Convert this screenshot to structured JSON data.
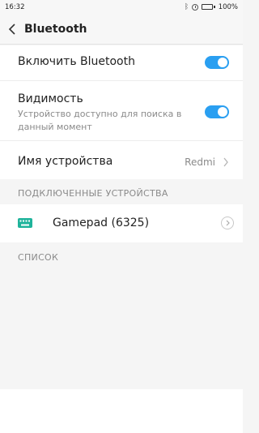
{
  "status_bar": {
    "time": "16:32",
    "battery": "100%",
    "bluetooth_icon": "bluetooth-icon",
    "alarm_icon": "alarm-icon",
    "battery_icon": "battery-icon"
  },
  "header": {
    "title": "Bluetooth",
    "back_icon": "chevron-left-icon"
  },
  "settings": {
    "enable_bluetooth": {
      "label": "Включить Bluetooth",
      "enabled": true
    },
    "visibility": {
      "label": "Видимость",
      "description": "Устройство доступно для поиска в данный момент",
      "enabled": true
    },
    "device_name": {
      "label": "Имя устройства",
      "value": "Redmi"
    }
  },
  "connected_devices": {
    "header": "ПОДКЛЮЧЕННЫЕ УСТРОЙСТВА",
    "items": [
      {
        "name": "Gamepad (6325)",
        "icon": "keyboard-icon"
      }
    ]
  },
  "list_section": {
    "header": "СПИСОК"
  },
  "colors": {
    "accent": "#2a9ff1",
    "device_icon": "#1fb39b",
    "secondary_text": "#8a8a8a",
    "background": "#f5f5f5"
  }
}
